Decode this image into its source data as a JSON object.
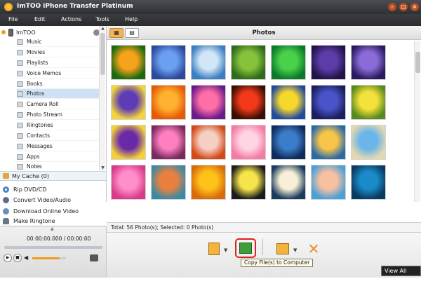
{
  "window": {
    "title": "ImTOO iPhone Transfer Platinum"
  },
  "menu": {
    "items": [
      "File",
      "Edit",
      "Actions",
      "Tools",
      "Help"
    ]
  },
  "sidebar": {
    "device": "ImTOO",
    "items": [
      {
        "label": "Music",
        "icon": "music-icon"
      },
      {
        "label": "Movies",
        "icon": "movies-icon"
      },
      {
        "label": "Playlists",
        "icon": "playlist-icon"
      },
      {
        "label": "Voice Memos",
        "icon": "voice-memo-icon"
      },
      {
        "label": "Books",
        "icon": "books-icon"
      },
      {
        "label": "Photos",
        "icon": "photos-icon"
      },
      {
        "label": "Camera Roll",
        "icon": "camera-icon"
      },
      {
        "label": "Photo Stream",
        "icon": "photo-stream-icon"
      },
      {
        "label": "Ringtones",
        "icon": "ringtone-icon"
      },
      {
        "label": "Contacts",
        "icon": "contacts-icon"
      },
      {
        "label": "Messages",
        "icon": "messages-icon"
      },
      {
        "label": "Apps",
        "icon": "apps-icon"
      },
      {
        "label": "Notes",
        "icon": "notes-icon"
      }
    ],
    "selected": "Photos",
    "my_cache": "My Cache (0)",
    "tools": [
      {
        "label": "Rip DVD/CD",
        "icon": "disc-icon"
      },
      {
        "label": "Convert Video/Audio",
        "icon": "convert-icon"
      },
      {
        "label": "Download Online Video",
        "icon": "download-icon"
      },
      {
        "label": "Make Ringtone",
        "icon": "bell-icon"
      }
    ]
  },
  "player": {
    "time": "00:00:00.000 / 00:00:00",
    "volume_level": 0.8
  },
  "main": {
    "title": "Photos"
  },
  "status": {
    "text": "Total: 56 Photo(s); Selected: 0 Photo(s)"
  },
  "tooltip": {
    "text": "Copy File(s) to Computer"
  },
  "view_all": "View All Tasks",
  "colors": {
    "accent": "#f3b35b",
    "selection": "#cfe1f5",
    "titlebar": "#3a3c40"
  }
}
